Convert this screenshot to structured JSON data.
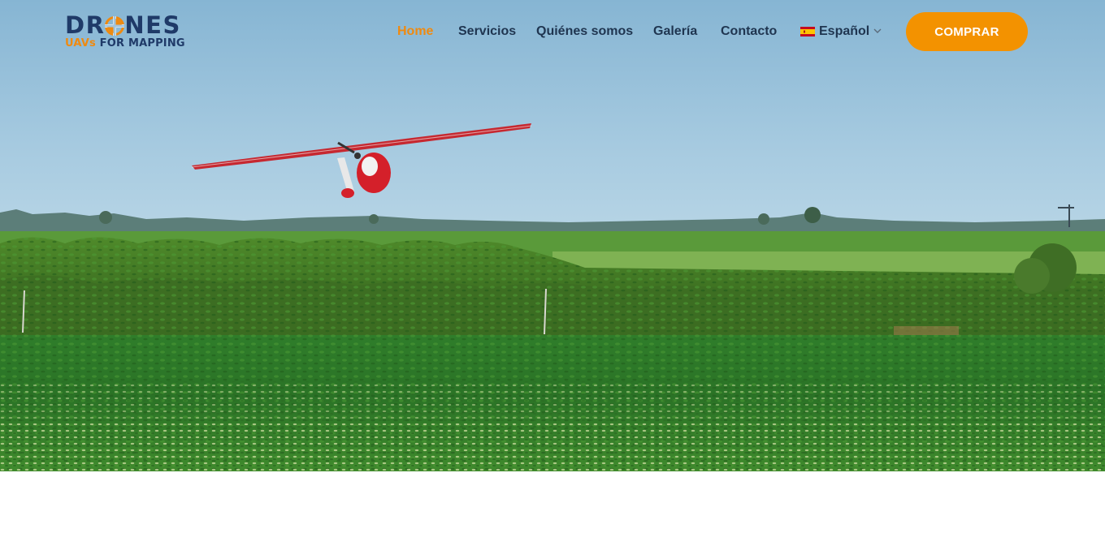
{
  "logo": {
    "brand_left": "DR",
    "brand_right": "NES",
    "tagline_accent": "UAVs",
    "tagline_rest": "FOR MAPPING"
  },
  "nav": {
    "items": [
      {
        "label": "Home",
        "active": true
      },
      {
        "label": "Servicios",
        "active": false
      },
      {
        "label": "Quiénes somos",
        "active": false
      },
      {
        "label": "Galería",
        "active": false
      },
      {
        "label": "Contacto",
        "active": false
      }
    ],
    "language": {
      "label": "Español",
      "flag": "spain-flag-icon"
    },
    "cta_label": "COMPRAR"
  },
  "hero": {
    "image": "fixed-wing drone flying over green soybean field"
  },
  "colors": {
    "brand_navy": "#1f3a68",
    "accent_orange": "#f39200",
    "active_nav": "#ef8a10",
    "nav_text": "#1f3550"
  }
}
